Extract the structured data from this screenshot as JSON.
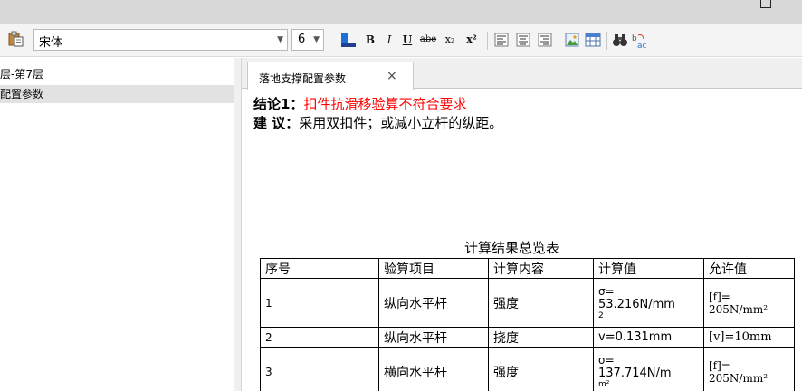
{
  "window": {
    "restore_icon": "restore-window-icon"
  },
  "toolbar": {
    "paste_icon": "paste-icon",
    "font_name": "宋体",
    "font_size": "6",
    "dropdown_icon": "chevron-down-icon",
    "buttons": [
      {
        "name": "font-color-button",
        "icon": "font-color-icon",
        "accent": "#1f6fd8"
      },
      {
        "name": "bold-button",
        "label": "B"
      },
      {
        "name": "italic-button",
        "label": "I"
      },
      {
        "name": "underline-button",
        "label": "U"
      },
      {
        "name": "strikethrough-button",
        "label": "abe"
      },
      {
        "name": "subscript-button",
        "label": "x₂"
      },
      {
        "name": "superscript-button",
        "label": "x²"
      },
      {
        "name": "align-left-button",
        "icon": "align-left-icon"
      },
      {
        "name": "align-center-button",
        "icon": "align-center-icon"
      },
      {
        "name": "align-right-button",
        "icon": "align-right-icon"
      },
      {
        "name": "insert-image-button",
        "icon": "image-icon"
      },
      {
        "name": "insert-table-button",
        "icon": "table-icon"
      },
      {
        "name": "find-button",
        "icon": "binoculars-icon"
      },
      {
        "name": "replace-button",
        "icon": "replace-icon"
      }
    ]
  },
  "sidebar": {
    "items": [
      {
        "label": "层-第7层",
        "selected": false
      },
      {
        "label": "配置参数",
        "selected": true
      }
    ]
  },
  "tabs": [
    {
      "label": "落地支撑配置参数",
      "close": "×",
      "active": true
    }
  ],
  "document": {
    "conclusion_label": "结论1：",
    "conclusion_text": "扣件抗滑移验算不符合要求",
    "suggestion_label": "建 议：",
    "suggestion_text": "采用双扣件；或减小立杆的纵距。",
    "table_caption": "计算结果总览表",
    "table_headers": [
      "序号",
      "验算项目",
      "计算内容",
      "计算值",
      "允许值"
    ],
    "table_rows": [
      {
        "no": "1",
        "item": "纵向水平杆",
        "content": "强度",
        "value_l1": "σ=",
        "value_l2": "53.216N/mm",
        "value_l3": "2",
        "allow_l1": "[f]=",
        "allow_l2": "205N/mm²"
      },
      {
        "no": "2",
        "item": "纵向水平杆",
        "content": "挠度",
        "value": "v=0.131mm",
        "allow": "[v]=10mm"
      },
      {
        "no": "3",
        "item": "横向水平杆",
        "content": "强度",
        "value_l1": "σ=",
        "value_l2": "137.714N/m",
        "value_l3": "m²",
        "allow_l1": "[f]=",
        "allow_l2": "205N/mm²"
      }
    ]
  },
  "colors": {
    "red_text": "#ff0000",
    "selection": "#e2e2e2",
    "toolbar_bg": "#f4f4f4"
  }
}
